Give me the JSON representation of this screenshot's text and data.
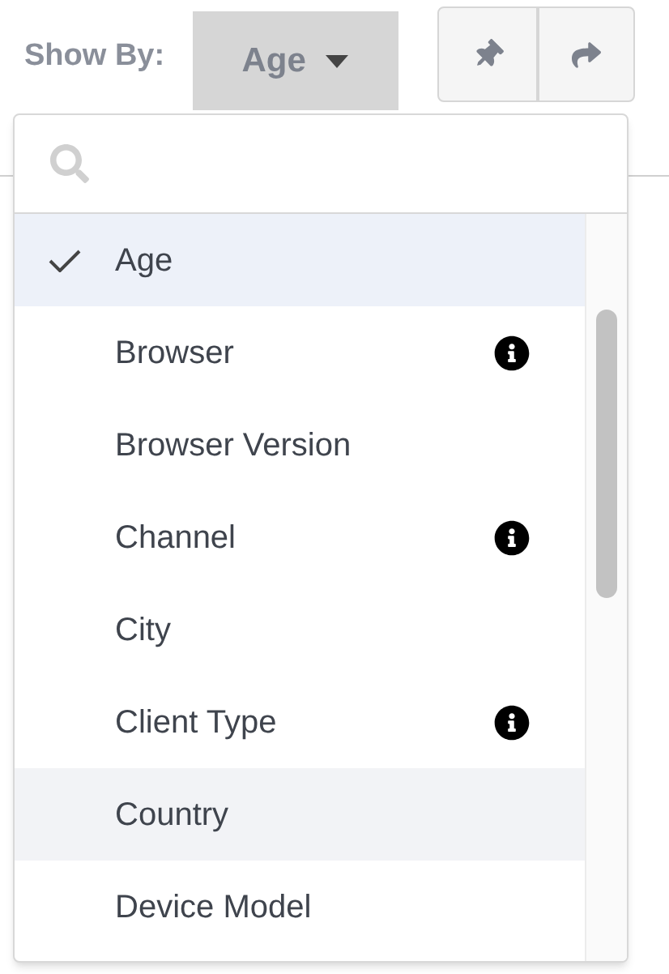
{
  "toolbar": {
    "label": "Show By:",
    "dropdown": {
      "value": "Age",
      "expanded": true
    }
  },
  "dropdown_menu": {
    "items": [
      {
        "label": "Age",
        "selected": true,
        "highlighted": false,
        "info": false
      },
      {
        "label": "Browser",
        "selected": false,
        "highlighted": false,
        "info": true
      },
      {
        "label": "Browser Version",
        "selected": false,
        "highlighted": false,
        "info": false
      },
      {
        "label": "Channel",
        "selected": false,
        "highlighted": false,
        "info": true
      },
      {
        "label": "City",
        "selected": false,
        "highlighted": false,
        "info": false
      },
      {
        "label": "Client Type",
        "selected": false,
        "highlighted": false,
        "info": true
      },
      {
        "label": "Country",
        "selected": false,
        "highlighted": true,
        "info": false
      },
      {
        "label": "Device Model",
        "selected": false,
        "highlighted": false,
        "info": false
      }
    ]
  }
}
